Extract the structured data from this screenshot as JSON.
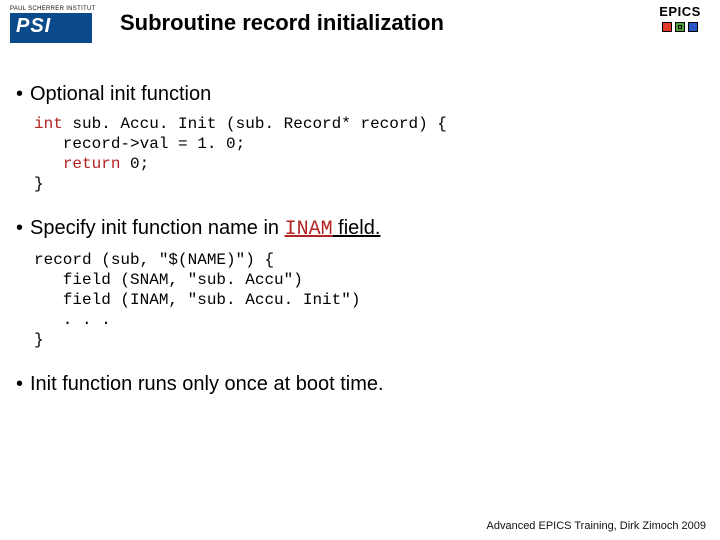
{
  "header": {
    "psi_tag": "PAUL SCHERRER INSTITUT",
    "psi_text": "PSI",
    "title": "Subroutine record initialization",
    "epics_label": "EPICS"
  },
  "bullets": {
    "b1": "Optional init function",
    "b2_pre": "Specify init function name in ",
    "b2_code": "INAM",
    "b2_post": " field.",
    "b3": "Init function runs only once at boot time."
  },
  "code1": {
    "l1a": "int",
    "l1b": " sub. Accu. Init (sub. Record* record) {",
    "l2": "   record->val = 1. 0;",
    "l3a": "   ",
    "l3b": "return",
    "l3c": " 0;",
    "l4": "}"
  },
  "code2": {
    "l1": "record (sub, \"$(NAME)\") {",
    "l2": "   field (SNAM, \"sub. Accu\")",
    "l3": "   field (INAM, \"sub. Accu. Init\")",
    "l4": "   . . .",
    "l5": "}"
  },
  "footer": "Advanced EPICS Training, Dirk Zimoch 2009"
}
